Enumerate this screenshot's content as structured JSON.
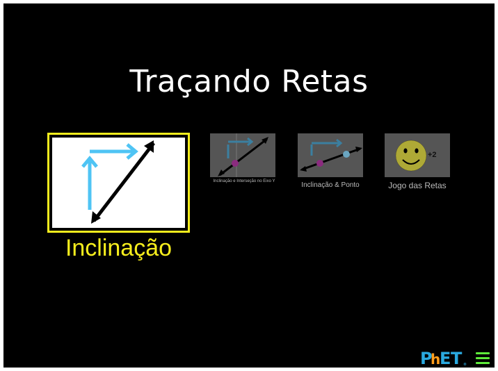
{
  "app": {
    "title": "Traçando Retas"
  },
  "screens": [
    {
      "label": "Inclinação",
      "selected": true
    },
    {
      "label": "Inclinação e Interseção no Eixo Y",
      "selected": false
    },
    {
      "label": "Inclinação & Ponto",
      "selected": false
    },
    {
      "label": "Jogo das Retas",
      "selected": false,
      "badge": "+2"
    }
  ],
  "brand": {
    "logo": "PhET",
    "menu_icon": "hamburger-menu-icon"
  },
  "colors": {
    "background": "#000000",
    "selected": "#f7ee1d",
    "arrow": "#4fc4f4",
    "menu": "#5eea3a"
  }
}
